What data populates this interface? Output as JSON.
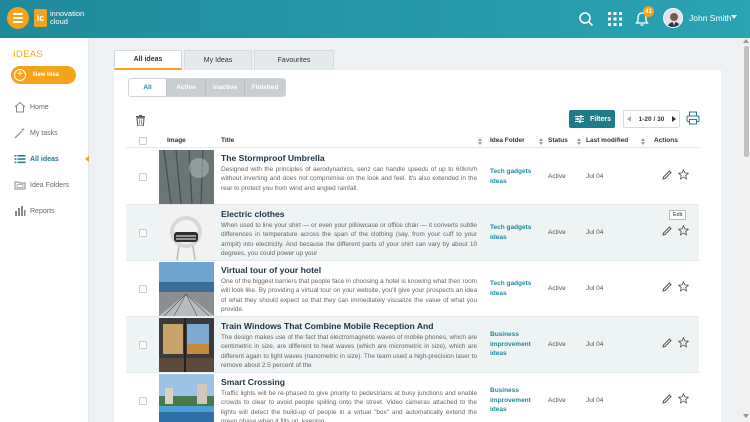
{
  "app": {
    "logo_mark": "ic",
    "logo_line1": "innovation",
    "logo_line2": "cloud",
    "user_name": "John Smith",
    "notification_count": "41"
  },
  "sidebar": {
    "title": "IDEAS",
    "new_idea_label": "New Idea",
    "items": [
      {
        "label": "Home",
        "icon": "home-icon"
      },
      {
        "label": "My tasks",
        "icon": "magic-wand-icon"
      },
      {
        "label": "All ideas",
        "icon": "list-icon",
        "active": true
      },
      {
        "label": "Idea Folders",
        "icon": "folder-icon"
      },
      {
        "label": "Reports",
        "icon": "bar-chart-icon"
      }
    ]
  },
  "tabs": [
    "All ideas",
    "My Ideas",
    "Favourites"
  ],
  "status_filters": [
    "All",
    "Active",
    "Inactive",
    "Finished"
  ],
  "toolbar": {
    "filters_label": "Filters",
    "pager_label": "1-20 / 30"
  },
  "table": {
    "headers": {
      "image": "Image",
      "title": "Title",
      "folder": "Idea Folder",
      "status": "Status",
      "modified": "Last modified",
      "actions": "Actions"
    },
    "tooltip": "Edit",
    "rows": [
      {
        "title": "The Stormproof Umbrella",
        "desc": "Designed with the principles of aerodynamics, senz can handle speeds of up to 60km/h without inverting and does not compromise on the look and feel. It's also extended in the rear to protect you from wind and angled rainfall.",
        "folder": "Tech gadgets ideas",
        "status": "Active",
        "modified": "Jul 04"
      },
      {
        "title": "Electric clothes",
        "desc": "When used to line your shirt — or even your pillowcase or office chair — it converts subtle differences in temperature across the span of the clothing (say, from your cuff to your armpit) into electricity. And because the different parts of your shirt can vary by about 10 degrees, you could power up your",
        "folder": "Tech gadgets ideas",
        "status": "Active",
        "modified": "Jul 04"
      },
      {
        "title": "Virtual tour of your hotel",
        "desc": "One of the biggest barriers that people face in choosing a hotel is knowing what their room will look like. By providing a virtual tour on your website, you'll give your prospects an idea of what they should expect so that they can immediately visualize the value of what you provide.",
        "folder": "Tech gadgets ideas",
        "status": "Active",
        "modified": "Jul 04"
      },
      {
        "title": "Train Windows That Combine Mobile Reception And",
        "desc": "The design makes use of the fact that electromagnetic waves of mobile phones, which are centimetric in size, are different to heat waves (which are micrometric in size), which are different again to light waves (nanometric in size). The team used a high-precision laser to remove about 2.5 percent of the",
        "folder": "Business improvement ideas",
        "status": "Active",
        "modified": "Jul 04"
      },
      {
        "title": "Smart Crossing",
        "desc": "Traffic lights will be re-phased to give priority to pedestrians at busy junctions and enable crowds to clear to avoid people spilling onto the street. Video cameras attached to the lights will detect the build-up of people in a virtual \"box\" and automatically extend the green phase when it fills up, keeping",
        "folder": "Business improvement ideas",
        "status": "Active",
        "modified": "Jul 04"
      }
    ]
  }
}
